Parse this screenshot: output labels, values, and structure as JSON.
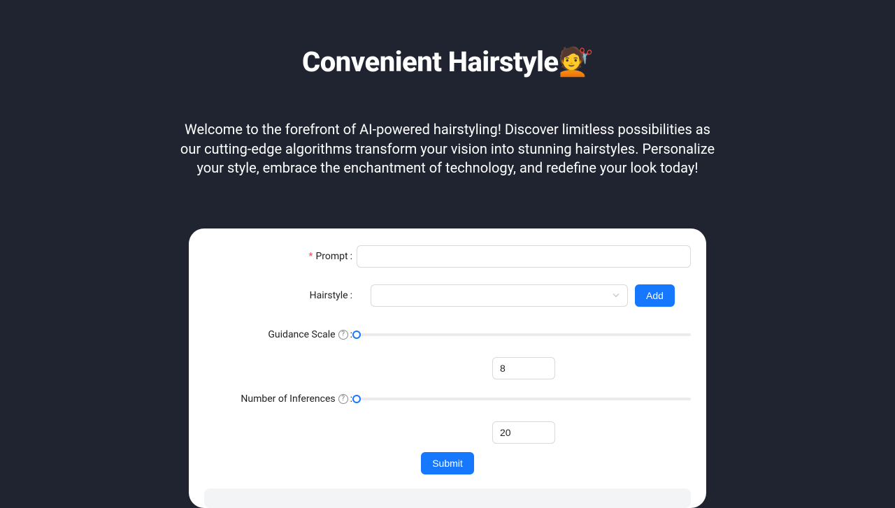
{
  "header": {
    "title": "Convenient Hairstyle💇",
    "intro": "Welcome to the forefront of AI-powered hairstyling! Discover limitless possibilities as our cutting-edge algorithms transform your vision into stunning hairstyles. Personalize your style, embrace the enchantment of technology, and redefine your look today!"
  },
  "form": {
    "prompt": {
      "label": "Prompt",
      "required": "*",
      "value": ""
    },
    "hairstyle": {
      "label": "Hairstyle",
      "selected": "",
      "add_label": "Add"
    },
    "guidance": {
      "label": "Guidance Scale",
      "value": "8"
    },
    "inferences": {
      "label": "Number of Inferences",
      "value": "20"
    },
    "submit_label": "Submit",
    "help_glyph": "?"
  }
}
